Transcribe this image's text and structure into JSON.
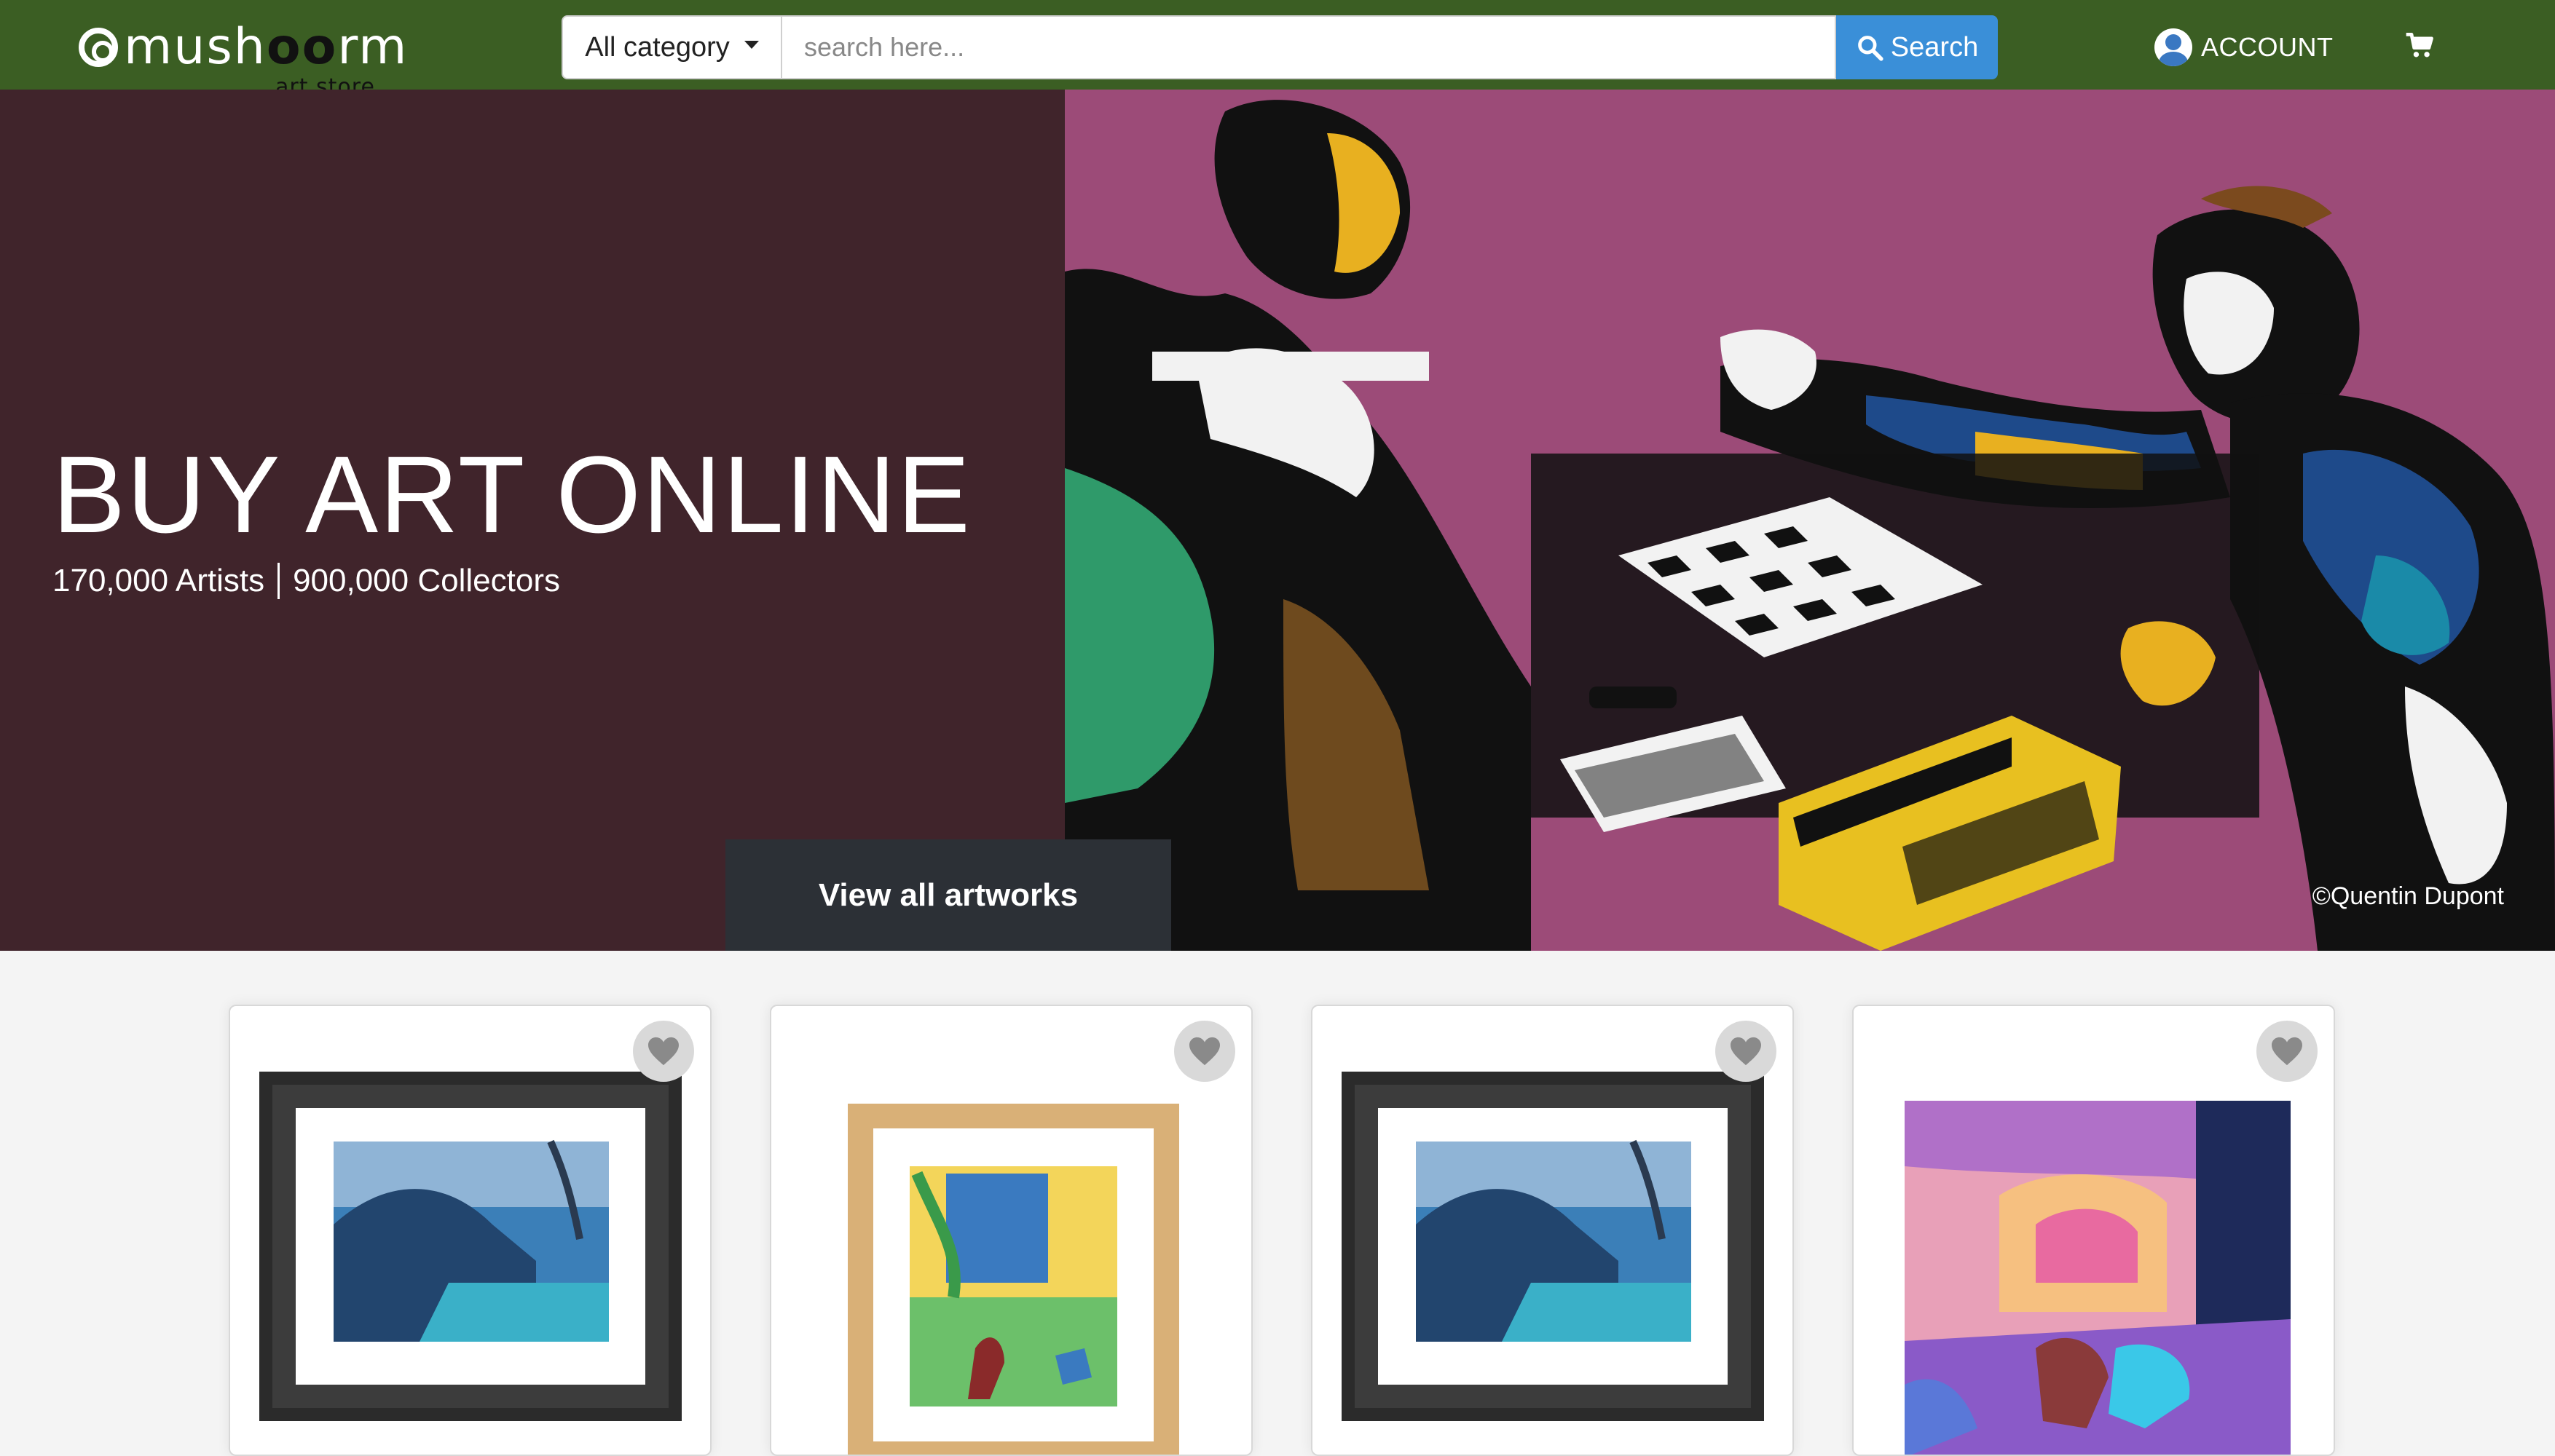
{
  "brand": {
    "name_prefix": "mush",
    "name_oo": "oo",
    "name_suffix": "rm",
    "tagline": "art store"
  },
  "search": {
    "category_label": "All category",
    "placeholder": "search here...",
    "button_label": "Search"
  },
  "account": {
    "label": "ACCOUNT"
  },
  "hero": {
    "title": "BUY ART ONLINE",
    "artists": "170,000 Artists",
    "collectors": "900,000 Collectors",
    "cta": "View all artworks",
    "credit": "©Quentin Dupont"
  },
  "products": [
    {
      "frame": "black",
      "artwork": "pool"
    },
    {
      "frame": "natural-wood",
      "artwork": "window"
    },
    {
      "frame": "black",
      "artwork": "pool"
    },
    {
      "frame": "none",
      "artwork": "dream-room"
    }
  ],
  "colors": {
    "navbar": "#3b5e23",
    "hero_left": "#40242b",
    "search_button": "#3a8fd8",
    "cta_bg": "#2c3036"
  },
  "icons": [
    "search-icon",
    "account-icon",
    "cart-icon",
    "heart-icon",
    "chevron-down-icon"
  ]
}
